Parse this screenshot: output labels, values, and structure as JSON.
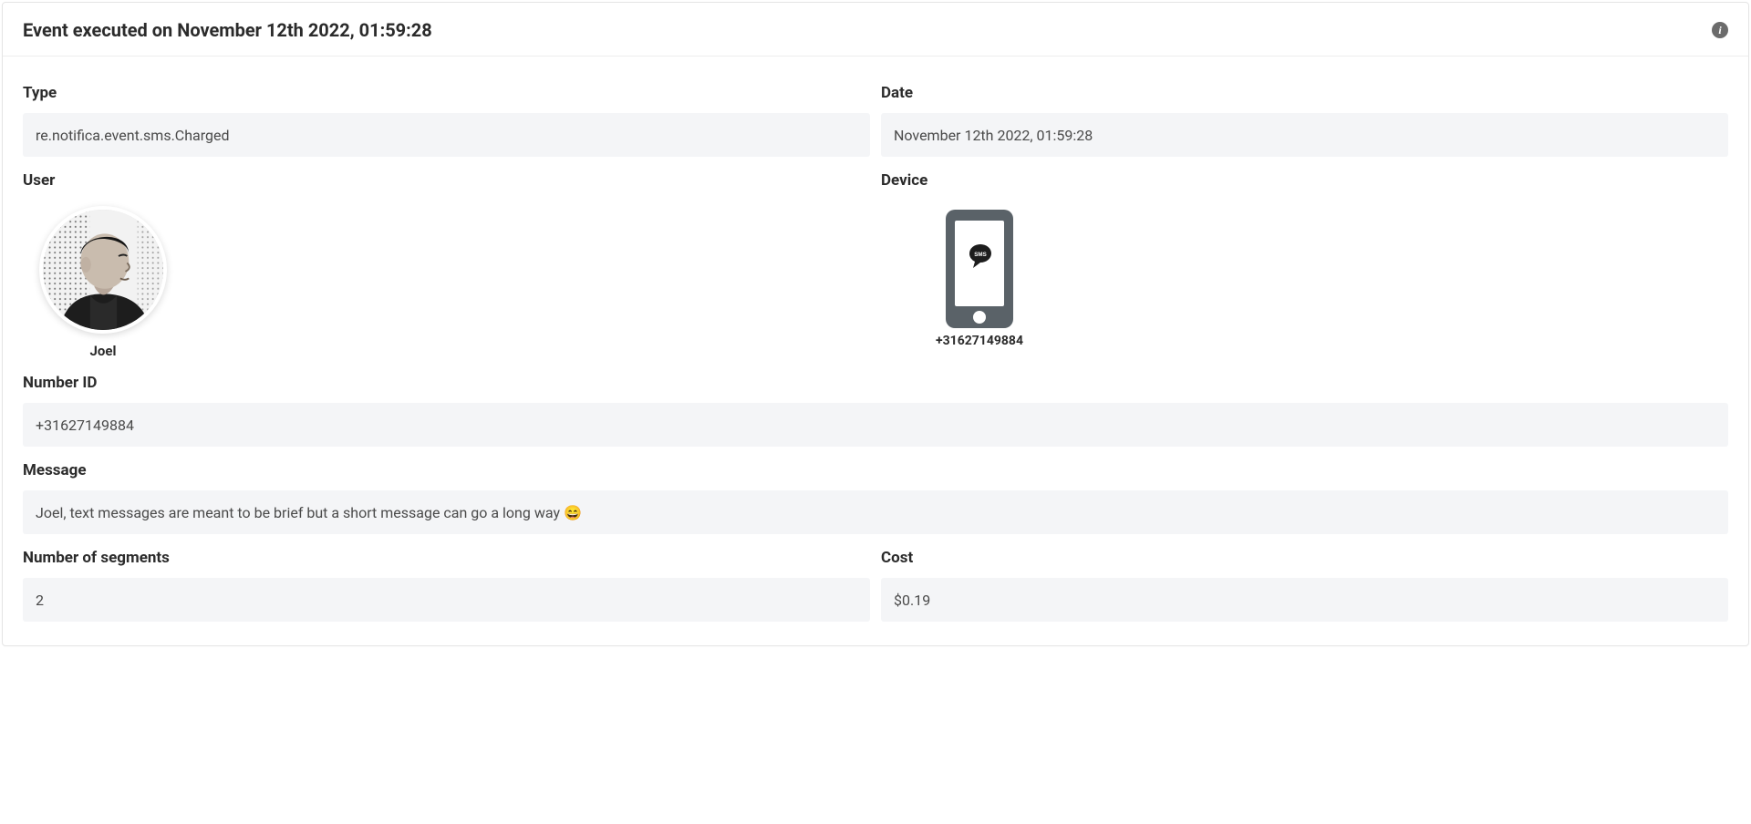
{
  "header": {
    "title": "Event executed on November 12th 2022, 01:59:28"
  },
  "fields": {
    "type_label": "Type",
    "type_value": "re.notifica.event.sms.Charged",
    "date_label": "Date",
    "date_value": "November 12th 2022, 01:59:28",
    "user_label": "User",
    "user_name": "Joel",
    "device_label": "Device",
    "device_value": "+31627149884",
    "number_id_label": "Number ID",
    "number_id_value": "+31627149884",
    "message_label": "Message",
    "message_value": "Joel, text messages are meant to be brief but a short message can go a long way 😄",
    "segments_label": "Number of segments",
    "segments_value": "2",
    "cost_label": "Cost",
    "cost_value": "$0.19"
  },
  "icons": {
    "info": "i",
    "sms": "SMS"
  }
}
